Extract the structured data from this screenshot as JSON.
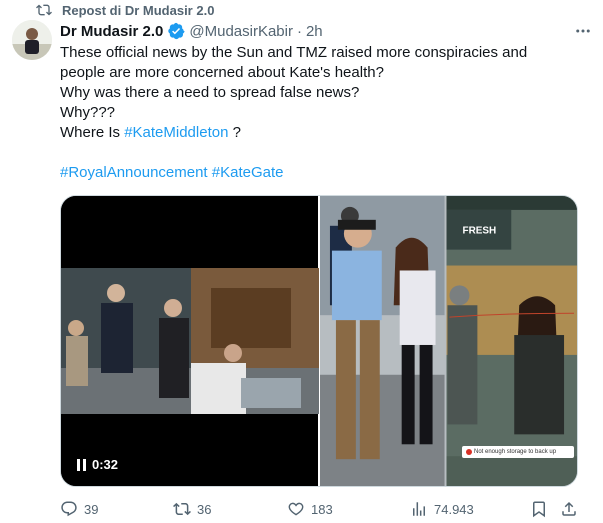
{
  "repost": {
    "label": "Repost di Dr Mudasir 2.0",
    "icon": "repost-icon"
  },
  "author": {
    "name": "Dr Mudasir 2.0",
    "handle": "@MudasirKabir",
    "separator": "·",
    "time": "2h",
    "verified_color": "#1d9bf0"
  },
  "tweet": {
    "lines": [
      "These official news by the Sun and TMZ raised more conspiracies and",
      "people are more concerned about Kate's health?",
      "Why was there a need to spread false news?",
      "Why???"
    ],
    "where_prefix": "Where Is ",
    "where_tag": "#KateMiddleton",
    "where_suffix": " ?",
    "tag1": "#RoyalAnnouncement",
    "tag2": "#KateGate"
  },
  "media": {
    "video_time": "0:32",
    "storage_note": "Not enough storage to back up",
    "store_sign": "FRESH"
  },
  "actions": {
    "replies": "39",
    "reposts": "36",
    "likes": "183",
    "views": "74.943"
  },
  "colors": {
    "link": "#1d9bf0",
    "muted": "#536471",
    "text": "#0f1419"
  }
}
